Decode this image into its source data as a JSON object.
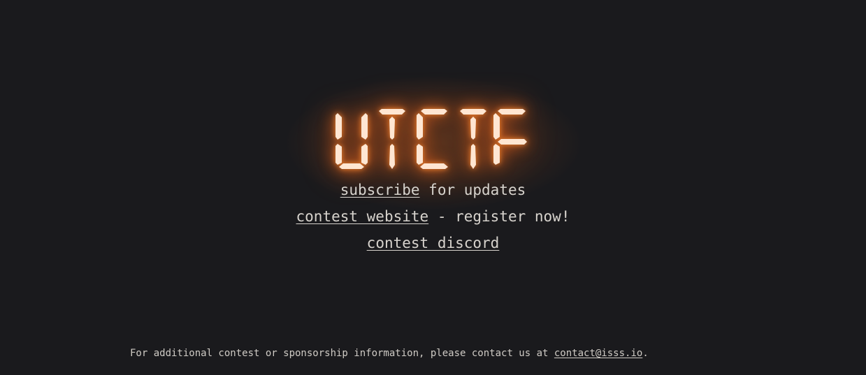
{
  "logo": {
    "text": "UTCTF",
    "glow_color": "#ff7a1e",
    "segment_color": "#ffe6d2"
  },
  "links": {
    "subscribe": {
      "label": "subscribe",
      "suffix": " for updates"
    },
    "website": {
      "label": "contest website",
      "suffix": " - register now!"
    },
    "discord": {
      "label": "contest discord"
    }
  },
  "footer": {
    "text": "For additional contest or sponsorship information, please contact us at ",
    "email": "contact@isss.io",
    "end": "."
  },
  "colors": {
    "background": "#1a1a1d",
    "text": "#d7d3cd"
  }
}
